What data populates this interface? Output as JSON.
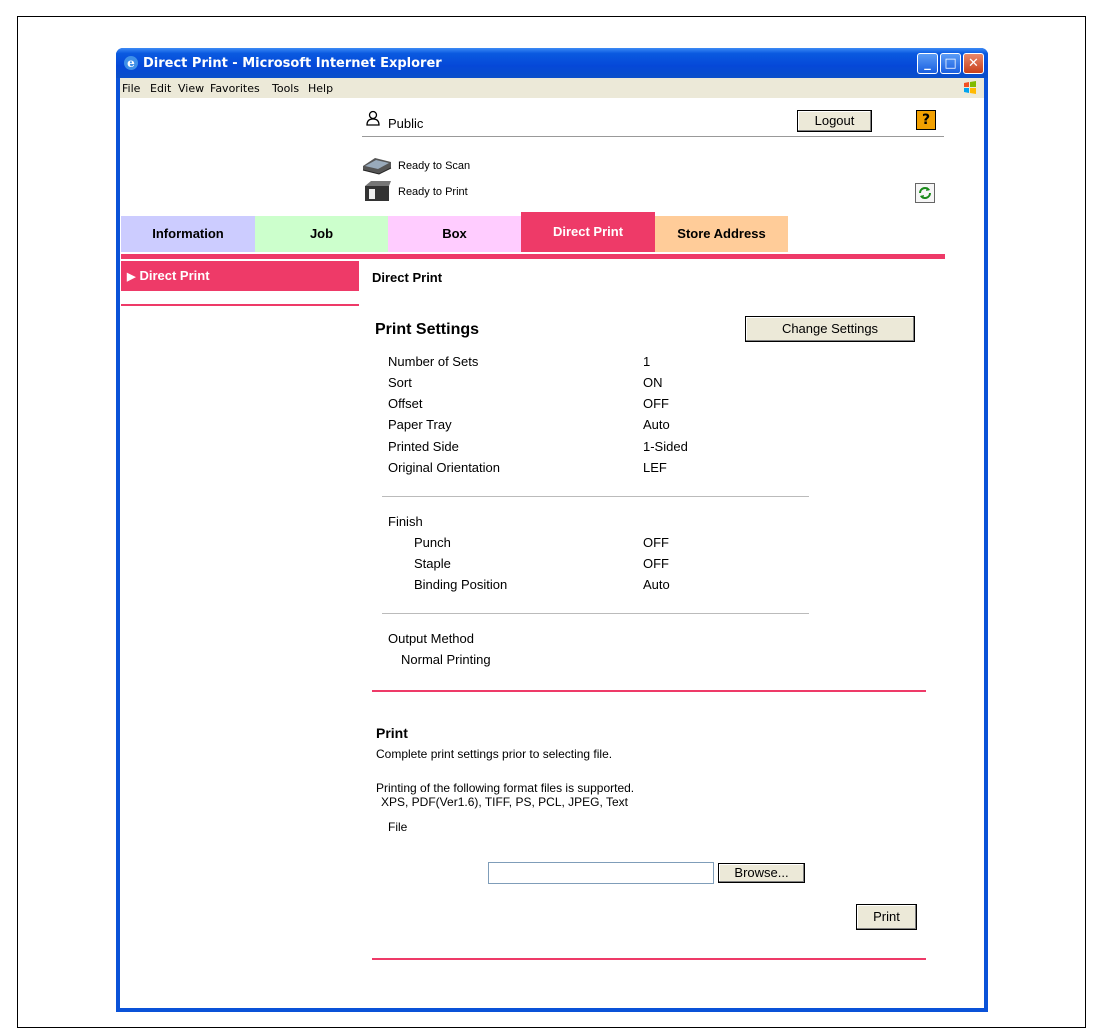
{
  "window": {
    "title": "Direct Print - Microsoft Internet Explorer",
    "menu": [
      "File",
      "Edit",
      "View",
      "Favorites",
      "Tools",
      "Help"
    ],
    "controls": [
      "_",
      "□",
      "✕"
    ]
  },
  "header": {
    "user_name": "Public",
    "logout_label": "Logout",
    "help_label": "?",
    "status": [
      {
        "text": "Ready to Scan",
        "icon": "scanner-icon"
      },
      {
        "text": "Ready to Print",
        "icon": "printer-icon"
      }
    ]
  },
  "tabs": [
    {
      "label": "Information",
      "color": "#ccccff",
      "text_color": "#000000"
    },
    {
      "label": "Job",
      "color": "#ccffcc",
      "text_color": "#000000"
    },
    {
      "label": "Box",
      "color": "#ffccff",
      "text_color": "#000000"
    },
    {
      "label": "Direct Print",
      "color": "#ee3a68",
      "text_color": "#ffffff",
      "active": true
    },
    {
      "label": "Store Address",
      "color": "#ffcc99",
      "text_color": "#000000"
    }
  ],
  "sidebar": {
    "items": [
      {
        "label": "Direct Print",
        "active": true
      }
    ]
  },
  "main": {
    "heading": "Direct Print",
    "print_settings": {
      "title": "Print Settings",
      "change_button": "Change Settings",
      "rows": [
        {
          "label": "Number of Sets",
          "value": "1"
        },
        {
          "label": "Sort",
          "value": "ON"
        },
        {
          "label": "Offset",
          "value": "OFF"
        },
        {
          "label": "Paper Tray",
          "value": "Auto"
        },
        {
          "label": "Printed Side",
          "value": "1-Sided"
        },
        {
          "label": "Original Orientation",
          "value": "LEF"
        }
      ],
      "finish": {
        "label": "Finish",
        "rows": [
          {
            "label": "Punch",
            "value": "OFF"
          },
          {
            "label": "Staple",
            "value": "OFF"
          },
          {
            "label": "Binding Position",
            "value": "Auto"
          }
        ]
      },
      "output": {
        "label": "Output Method",
        "value": "Normal Printing"
      }
    },
    "print": {
      "title": "Print",
      "note": "Complete print settings prior to selecting file.",
      "supported_line1": "Printing of the following format files is supported.",
      "supported_line2": "XPS, PDF(Ver1.6), TIFF, PS, PCL, JPEG, Text",
      "file_label": "File",
      "file_value": "",
      "browse_label": "Browse...",
      "print_label": "Print"
    }
  },
  "colors": {
    "accent": "#ee3a68",
    "title_bar": "#0a52d8",
    "button_face": "#ece9d8"
  }
}
